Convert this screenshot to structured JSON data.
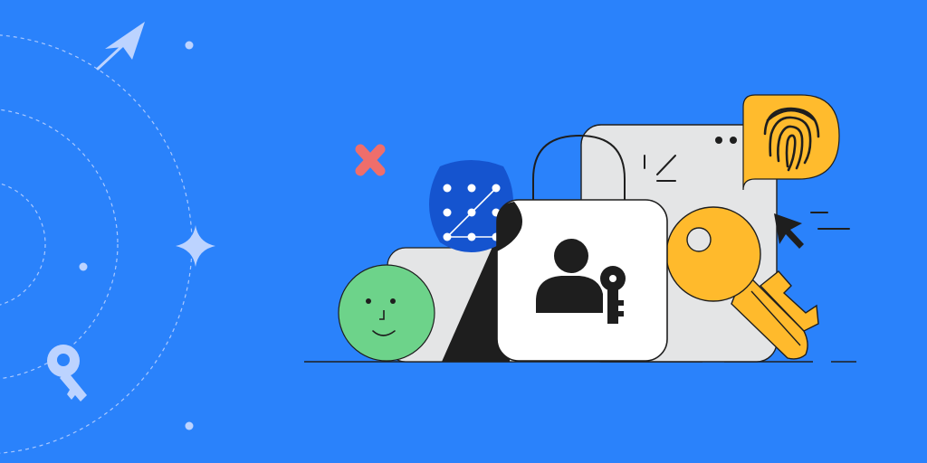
{
  "illustration": {
    "theme": "passkeys-security",
    "colors": {
      "background": "#2a82fb",
      "dashed_orbit": "#a9c8ff",
      "pale_accent": "#bcd3ff",
      "panel_grey": "#e4e5e6",
      "ink": "#1e1e1e",
      "pattern_blob": "#1554cf",
      "face_green": "#6dd38a",
      "key_yellow": "#ffba2c",
      "fingerprint_yellow": "#ffbb2d",
      "x_mark": "#ef6e6b",
      "white": "#ffffff"
    },
    "elements": {
      "lock": "padlock-with-user-key-icon",
      "key": "golden-key-icon",
      "fingerprint": "fingerprint-icon",
      "pattern_unlock": "pattern-unlock-icon",
      "face": "smiling-face-icon",
      "cursor": "cursor-arrow-icon",
      "paper_plane": "paper-plane-icon",
      "sparkle": "sparkle-icon",
      "small_key": "small-key-icon",
      "x_mark": "x-mark-icon"
    }
  }
}
